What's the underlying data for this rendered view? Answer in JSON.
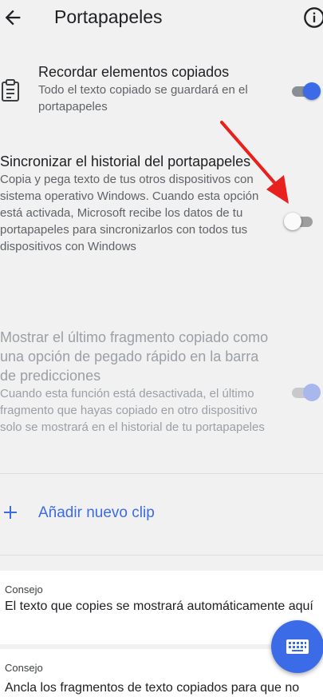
{
  "header": {
    "title": "Portapapeles"
  },
  "settings": [
    {
      "title": "Recordar elementos copiados",
      "description": "Todo el texto copiado se guardará en el portapapeles",
      "enabled": true
    },
    {
      "title": "Sincronizar el historial del portapapeles",
      "description": "Copia y pega texto de tus otros dispositivos con sistema operativo Windows. Cuando esta opción está activada, Microsoft recibe los datos de tu portapapeles para sincronizarlos con todos tus dispositivos con Windows",
      "enabled": false
    },
    {
      "title": "Mostrar el último fragmento copiado como una opción de pegado rápido en la barra de predicciones",
      "description": "Cuando esta función está desactivada, el último fragmento que hayas copiado en otro dispositivo solo se mostrará en el historial de tu portapapeles",
      "enabled": true,
      "disabled": true
    }
  ],
  "add_clip": {
    "label": "Añadir nuevo clip"
  },
  "tips": [
    {
      "label": "Consejo",
      "text": "El texto que copies se mostrará automáticamente aquí"
    },
    {
      "label": "Consejo",
      "text": "Ancla los fragmentos de texto copiados para que no"
    }
  ],
  "colors": {
    "accent": "#3c6be8",
    "annotation": "#e8201e"
  },
  "icons": {
    "back": "arrow-left",
    "info": "info-circle",
    "clipboard": "clipboard",
    "add": "plus",
    "fab": "keyboard"
  }
}
